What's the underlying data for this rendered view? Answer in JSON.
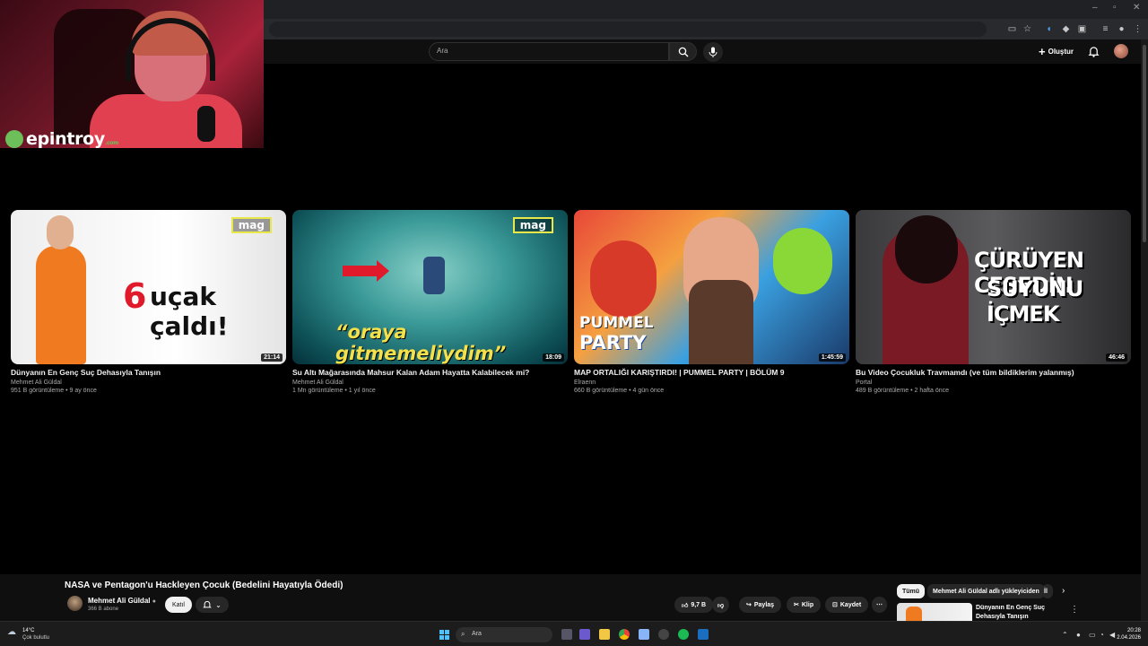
{
  "youtube": {
    "search_placeholder": "Ara",
    "create_label": "Oluştur"
  },
  "webcam": {
    "brand": "epintroy",
    "brand_tld": ".com"
  },
  "videos": [
    {
      "title": "Dünyanın En Genç Suç Dehasıyla Tanışın",
      "channel": "Mehmet Ali Güldal",
      "meta": "951 B görüntüleme • 9 ay önce",
      "duration": "21:14",
      "badge": "mag",
      "overlay_text_a": "6",
      "overlay_text_b": "uçak çaldı!"
    },
    {
      "title": "Su Altı Mağarasında Mahsur Kalan Adam Hayatta Kalabilecek mi?",
      "channel": "Mehmet Ali Güldal",
      "meta": "1 Mn görüntüleme • 1 yıl önce",
      "duration": "18:09",
      "badge": "mag",
      "overlay_text": "“oraya gitmemeliydim”"
    },
    {
      "title": "MAP ORTALIĞI KARIŞTIRDI! | PUMMEL PARTY | BÖLÜM 9",
      "channel": "Elraenn",
      "meta": "660 B görüntüleme • 4 gün önce",
      "duration": "1:45:59",
      "overlay_text_a": "PUMMEL",
      "overlay_text_b": "PARTY"
    },
    {
      "title": "Bu Video Çocukluk Travmamdı (ve tüm bildiklerim yalanmış)",
      "channel": "Portal",
      "meta": "489 B görüntüleme • 2 hafta önce",
      "duration": "46:46",
      "overlay_text_a": "ÇÜRÜYEN CESEDİN",
      "overlay_text_b": "SUYUNU İÇMEK"
    }
  ],
  "watch": {
    "title": "NASA ve Pentagon'u Hackleyen Çocuk (Bedelini Hayatıyla Ödedi)",
    "channel": "Mehmet Ali Güldal",
    "subscribers": "366 B abone",
    "join_label": "Katıl",
    "likes": "9,7 B",
    "share_label": "Paylaş",
    "clip_label": "Klip",
    "save_label": "Kaydet",
    "chip_all": "Tümü",
    "chip_channel": "Mehmet Ali Güldal adlı yükleyiciden",
    "chip_more": "İl",
    "next_video_title": "Dünyanın En Genç Suç Dehasıyla Tanışın"
  },
  "taskbar": {
    "temperature": "14°C",
    "weather": "Çok bulutlu",
    "search_placeholder": "Ara",
    "time": "20:28",
    "date": "2.04.2026"
  },
  "colors": {
    "accent_yellow": "#e8e84a",
    "thumb_red": "#e01a2a",
    "brand_green": "#6dbf5a"
  }
}
